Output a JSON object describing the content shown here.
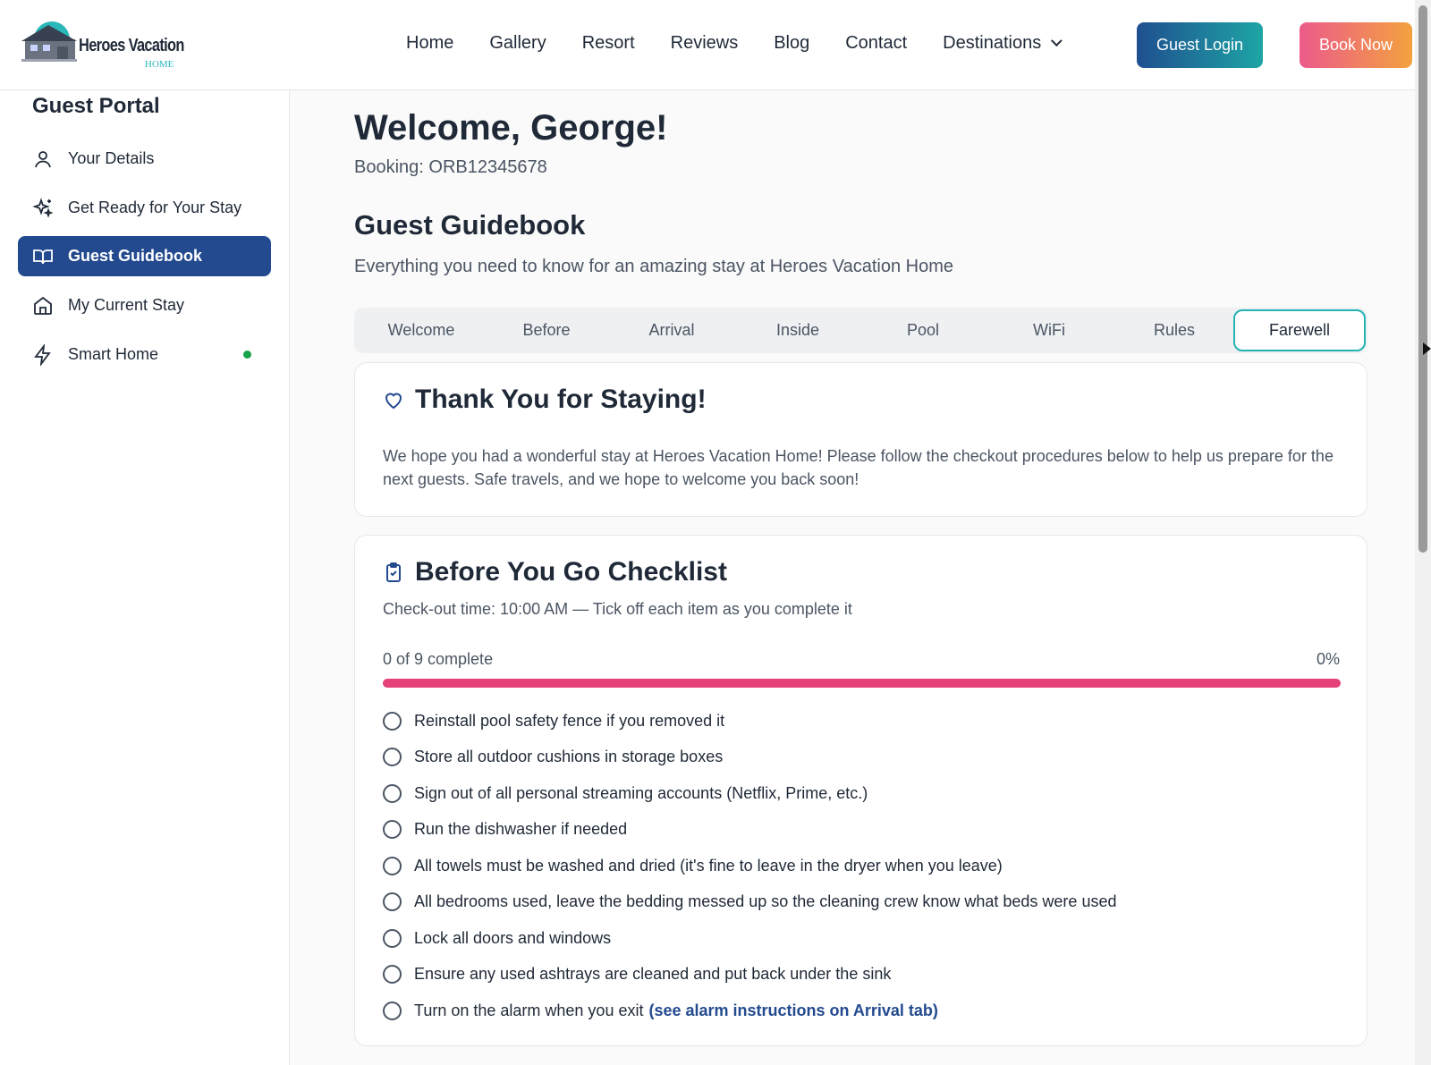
{
  "header": {
    "logo_text": "Heroes Vacation",
    "logo_sub": "HOME",
    "nav": [
      "Home",
      "Gallery",
      "Resort",
      "Reviews",
      "Blog",
      "Contact",
      "Destinations"
    ],
    "login_label": "Guest Login",
    "book_label": "Book Now"
  },
  "sidebar": {
    "title": "Guest Portal",
    "items": [
      {
        "label": "Your Details",
        "icon": "user-icon"
      },
      {
        "label": "Get Ready for Your Stay",
        "icon": "sparkles-icon"
      },
      {
        "label": "Guest Guidebook",
        "icon": "book-open-icon",
        "active": true
      },
      {
        "label": "My Current Stay",
        "icon": "home-icon"
      },
      {
        "label": "Smart Home",
        "icon": "lightning-icon",
        "status": "online"
      }
    ]
  },
  "main": {
    "welcome": "Welcome, George!",
    "booking": "Booking: ORB12345678",
    "guidebook_title": "Guest Guidebook",
    "guidebook_subtitle": "Everything you need to know for an amazing stay at Heroes Vacation Home",
    "tabs": [
      "Welcome",
      "Before",
      "Arrival",
      "Inside",
      "Pool",
      "WiFi",
      "Rules",
      "Farewell"
    ],
    "active_tab": "Farewell",
    "thanks": {
      "title": "Thank You for Staying!",
      "text": "We hope you had a wonderful stay at Heroes Vacation Home! Please follow the checkout procedures below to help us prepare for the next guests. Safe travels, and we hope to welcome you back soon!"
    },
    "checklist": {
      "title": "Before You Go Checklist",
      "checkout_text": "Check-out time: 10:00 AM — Tick off each item as you complete it",
      "progress_label": "0 of 9 complete",
      "progress_pct": "0%",
      "progress_fraction": 0,
      "items": [
        {
          "text": "Reinstall pool safety fence if you removed it"
        },
        {
          "text": "Store all outdoor cushions in storage boxes"
        },
        {
          "text": "Sign out of all personal streaming accounts (Netflix, Prime, etc.)"
        },
        {
          "text": "Run the dishwasher if needed"
        },
        {
          "text": "All towels must be washed and dried (it's fine to leave in the dryer when you leave)"
        },
        {
          "text": "All bedrooms used, leave the bedding messed up so the cleaning crew know what beds were used"
        },
        {
          "text": "Lock all doors and windows"
        },
        {
          "text": "Ensure any used ashtrays are cleaned and put back under the sink"
        },
        {
          "text": "Turn on the alarm when you exit",
          "link": "(see alarm instructions on Arrival tab)"
        }
      ]
    }
  },
  "colors": {
    "brand_blue": "#234a8f",
    "teal": "#26b3b3",
    "progress": "#e5427a",
    "online": "#16a34a"
  }
}
